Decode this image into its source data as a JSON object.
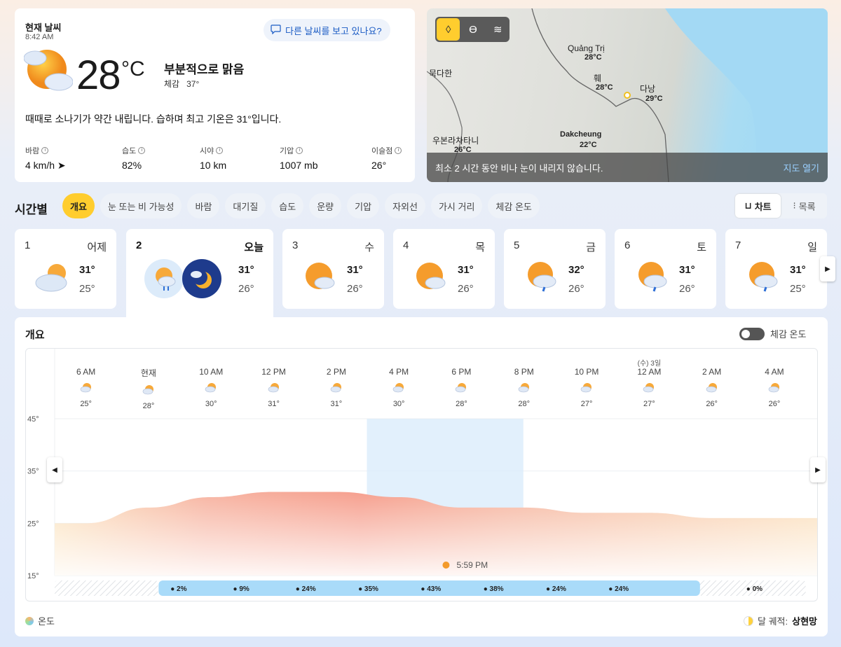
{
  "current": {
    "title": "현재 날씨",
    "time": "8:42 AM",
    "question": "다른 날씨를 보고 있나요?",
    "temp": "28",
    "unit": "°C",
    "condition": "부분적으로 맑음",
    "feels_label": "체감",
    "feels_value": "37°",
    "description": "때때로 소나기가 약간 내립니다. 습하며 최고 기온은 31°입니다.",
    "stats": [
      {
        "label": "바람",
        "value": "4 km/h"
      },
      {
        "label": "습도",
        "value": "82%"
      },
      {
        "label": "시야",
        "value": "10 km"
      },
      {
        "label": "기압",
        "value": "1007 mb"
      },
      {
        "label": "이슬점",
        "value": "26°"
      }
    ]
  },
  "map": {
    "places": [
      {
        "name": "Quảng Trị",
        "temp": "28°C"
      },
      {
        "name": "훼",
        "temp": "28°C"
      },
      {
        "name": "다낭",
        "temp": "29°C"
      },
      {
        "name": "Dakcheung",
        "temp": "22°C"
      },
      {
        "name": "우본라차타니",
        "temp": "26°C"
      },
      {
        "name": "묵다한",
        "temp": ""
      }
    ],
    "notice": "최소 2 시간 동안 비나 눈이 내리지 않습니다.",
    "open_label": "지도 열기"
  },
  "hourly": {
    "title": "시간별",
    "pills": [
      "개요",
      "눈 또는 비 가능성",
      "바람",
      "대기질",
      "습도",
      "운량",
      "기압",
      "자외선",
      "가시 거리",
      "체감 온도"
    ],
    "view_chart": "차트",
    "view_list": "목록"
  },
  "days": [
    {
      "num": "1",
      "name": "어제",
      "hi": "31°",
      "lo": "25°"
    },
    {
      "num": "2",
      "name": "오늘",
      "hi": "31°",
      "lo": "26°"
    },
    {
      "num": "3",
      "name": "수",
      "hi": "31°",
      "lo": "26°"
    },
    {
      "num": "4",
      "name": "목",
      "hi": "31°",
      "lo": "26°"
    },
    {
      "num": "5",
      "name": "금",
      "hi": "32°",
      "lo": "26°"
    },
    {
      "num": "6",
      "name": "토",
      "hi": "31°",
      "lo": "26°"
    },
    {
      "num": "7",
      "name": "일",
      "hi": "31°",
      "lo": "25°"
    }
  ],
  "overview": {
    "title": "개요",
    "feels_toggle": "체감 온도",
    "legend_left": "온도",
    "legend_right_label": "달 궤적:",
    "legend_right_value": "상현망",
    "sunset": "5:59 PM"
  },
  "chart_data": {
    "type": "area",
    "hours": [
      {
        "day_label": "",
        "time": "6 AM",
        "temp": 25
      },
      {
        "day_label": "",
        "time": "현재",
        "temp": 28
      },
      {
        "day_label": "",
        "time": "10 AM",
        "temp": 30
      },
      {
        "day_label": "",
        "time": "12 PM",
        "temp": 31
      },
      {
        "day_label": "",
        "time": "2 PM",
        "temp": 31
      },
      {
        "day_label": "",
        "time": "4 PM",
        "temp": 30
      },
      {
        "day_label": "",
        "time": "6 PM",
        "temp": 28
      },
      {
        "day_label": "",
        "time": "8 PM",
        "temp": 28
      },
      {
        "day_label": "",
        "time": "10 PM",
        "temp": 27
      },
      {
        "day_label": "(수) 3일",
        "time": "12 AM",
        "temp": 27
      },
      {
        "day_label": "",
        "time": "2 AM",
        "temp": 26
      },
      {
        "day_label": "",
        "time": "4 AM",
        "temp": 26
      }
    ],
    "y_ticks": [
      "45°",
      "35°",
      "25°",
      "15°"
    ],
    "ylim": [
      15,
      45
    ],
    "precip": [
      "2%",
      "9%",
      "24%",
      "35%",
      "43%",
      "38%",
      "24%",
      "24%",
      "0%"
    ]
  },
  "colors": {
    "accent": "#ffcd2e",
    "link": "#1a5bc4",
    "precip_bar": "#a9dbf9",
    "warm": "#f6a08f",
    "cool": "#fbe3bf"
  }
}
